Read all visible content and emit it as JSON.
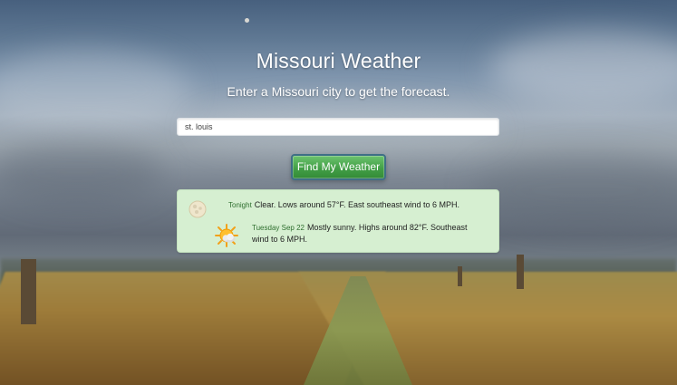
{
  "header": {
    "title": "Missouri Weather",
    "subtitle": "Enter a Missouri city to get the forecast."
  },
  "search": {
    "value": "st. louis"
  },
  "actions": {
    "find_label": "Find My Weather"
  },
  "forecast": {
    "items": [
      {
        "period": "Tonight",
        "text": "Clear. Lows around 57°F. East southeast wind to 6 MPH.",
        "icon": "moon-icon"
      },
      {
        "period": "Tuesday Sep 22",
        "text": "Mostly sunny. Highs around 82°F. Southeast wind to 6 MPH.",
        "icon": "sun-cloud-icon"
      }
    ]
  },
  "colors": {
    "accent": "#43a047",
    "panel": "#d6efd1",
    "button_border": "#3f6f86"
  }
}
